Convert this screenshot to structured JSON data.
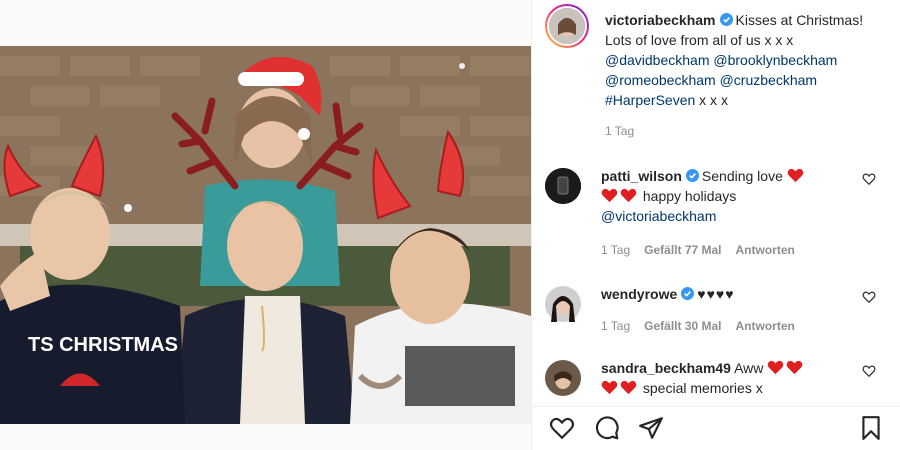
{
  "post": {
    "author": "victoriabeckham",
    "caption_text": "Kisses at Christmas! Lots of love from all of us x x x",
    "mentions": [
      "@davidbeckham",
      "@brooklynbeckham",
      "@romeobeckham",
      "@cruzbeckham"
    ],
    "hashtag": "#HarperSeven",
    "caption_tail": "x x x",
    "time": "1 Tag",
    "image_text": "TS CHRISTMAS"
  },
  "comments": [
    {
      "username": "patti_wilson",
      "verified": true,
      "text_a": "Sending love",
      "text_b": "happy holidays",
      "mention": "@victoriabeckham",
      "time": "1 Tag",
      "likes": "Gefällt 77 Mal",
      "reply": "Antworten"
    },
    {
      "username": "wendyrowe",
      "verified": true,
      "text_a": "♥♥♥♥",
      "time": "1 Tag",
      "likes": "Gefällt 30 Mal",
      "reply": "Antworten"
    },
    {
      "username": "sandra_beckham49",
      "verified": false,
      "text_a": "Aww",
      "text_b": "special memories x"
    }
  ],
  "colors": {
    "link": "#00376b",
    "muted": "#8e8e8e",
    "verified": "#3897f0",
    "heart": "#e02020"
  },
  "icons": [
    "verified-badge-icon",
    "heart-icon",
    "comment-icon",
    "share-icon",
    "bookmark-icon"
  ]
}
